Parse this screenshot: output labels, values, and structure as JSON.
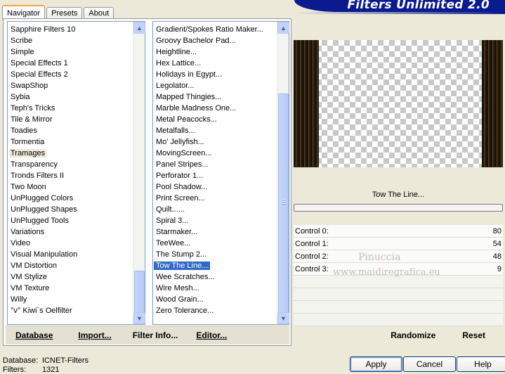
{
  "tabs": [
    "Navigator",
    "Presets",
    "About"
  ],
  "banner_title": "Filters Unlimited 2.0",
  "categories": [
    "Sapphire Filters 10",
    "Scribe",
    "Simple",
    "Special Effects 1",
    "Special Effects 2",
    "SwapShop",
    "Sybia",
    "Teph's Tricks",
    "Tile & Mirror",
    "Toadies",
    "Tormentia",
    "Tramages",
    "Transparency",
    "Tronds Filters II",
    "Two Moon",
    "UnPlugged Colors",
    "UnPlugged Shapes",
    "UnPlugged Tools",
    "Variations",
    "Video",
    "Visual Manipulation",
    "VM Distortion",
    "VM Stylize",
    "VM Texture",
    "Willy",
    "°v° Kiwi`s Oelfilter"
  ],
  "selected_category": "Tramages",
  "filters": [
    "Gradient/Spokes Ratio Maker...",
    "Groovy Bachelor Pad...",
    "Heightline...",
    "Hex Lattice...",
    "Holidays in Egypt...",
    "Legolator...",
    "Mapped Thingies...",
    "Marble Madness One...",
    "Metal Peacocks...",
    "Metalfalls...",
    "Mo' Jellyfish...",
    "MovingScreen...",
    "Panel Stripes...",
    "Perforator 1...",
    "Pool Shadow...",
    "Print Screen...",
    "Quilt......",
    "Spiral 3...",
    "Starmaker...",
    "TeeWee...",
    "The Stump 2...",
    "Tow The Line...",
    "Wee Scratches...",
    "Wire Mesh...",
    "Wood Grain...",
    "Zero Tolerance..."
  ],
  "selected_filter": "Tow The Line...",
  "left_buttons": {
    "database": "Database",
    "import": "Import...",
    "filter_info": "Filter Info...",
    "editor": "Editor..."
  },
  "filter_name": "Tow The Line...",
  "controls": [
    {
      "label": "Control 0:",
      "value": "80"
    },
    {
      "label": "Control 1:",
      "value": "54"
    },
    {
      "label": "Control 2:",
      "value": "48"
    },
    {
      "label": "Control 3:",
      "value": "9"
    }
  ],
  "right_buttons": {
    "randomize": "Randomize",
    "reset": "Reset"
  },
  "status": {
    "database_label": "Database:",
    "database_value": "ICNET-Filters",
    "filters_label": "Filters:",
    "filters_value": "1321"
  },
  "dialog_buttons": {
    "apply": "Apply",
    "cancel": "Cancel",
    "help": "Help"
  },
  "watermark": {
    "name": "Pinuccia",
    "site": "www.maidiregrafica.eu"
  }
}
